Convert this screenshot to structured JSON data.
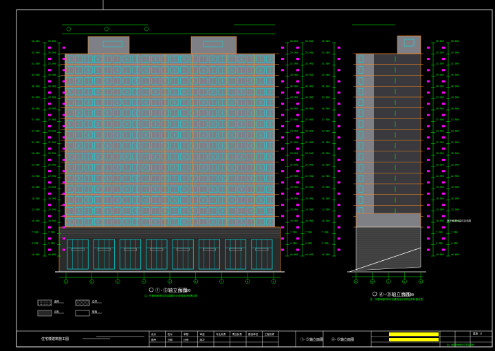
{
  "drawing": {
    "front_elevation_title": "①-⑤轴立面图",
    "front_elevation_scale": "1:100",
    "front_elevation_note": "注：外墙饰面材料详见建筑设计说明及材料做法表",
    "side_elevation_title": "Ⓐ-Ⓓ轴立面图",
    "side_elevation_scale": "1:100",
    "side_elevation_note": "注：外墙饰面材料详见建筑设计说明及材料做法表",
    "side_level_note": "室外地坪标高详见总图",
    "roof_level_label": "±0.000",
    "left_levels": [
      "58.800",
      "55.900",
      "52.900",
      "49.900",
      "46.900",
      "43.900",
      "40.900",
      "37.900",
      "34.900",
      "31.900",
      "28.900",
      "25.900",
      "22.900",
      "19.900",
      "16.900",
      "13.900",
      "10.900",
      "7.900",
      "4.900",
      "±0.000"
    ],
    "legend": [
      {
        "pattern": "dots",
        "label": "面砖"
      },
      {
        "pattern": "hatch",
        "label": "石材"
      },
      {
        "pattern": "grid",
        "label": "涂料"
      },
      {
        "pattern": "blank",
        "label": "玻璃"
      }
    ],
    "axis_labels_front": [
      "1",
      "2",
      "3",
      "4",
      "5",
      "6",
      "7",
      "8",
      "9"
    ],
    "axis_labels_side": [
      "A",
      "B",
      "C",
      "D",
      "E"
    ],
    "title_block": {
      "project_name": "住宅楼建筑施工图",
      "drawing_name_1": "①-⑤轴立面图",
      "drawing_name_2": "Ⓐ-Ⓓ轴立面图",
      "cells": [
        "设计",
        "校对",
        "审核",
        "审定",
        "专业负责",
        "项目负责",
        "建设单位",
        "工程名称",
        "图号",
        "日期",
        "比例",
        "版次"
      ],
      "sheet_no": "建施-12",
      "footer_note": "注：本图纸未经许可不得复制"
    }
  },
  "colors": {
    "line_green": "#00ff00",
    "line_orange": "#ff8c1a",
    "window_cyan": "#00e5e5",
    "wall_gray": "#7f7f86",
    "text_magenta": "#ff00ff",
    "highlight_yellow": "#ffff00",
    "frame_white": "#ffffff"
  }
}
